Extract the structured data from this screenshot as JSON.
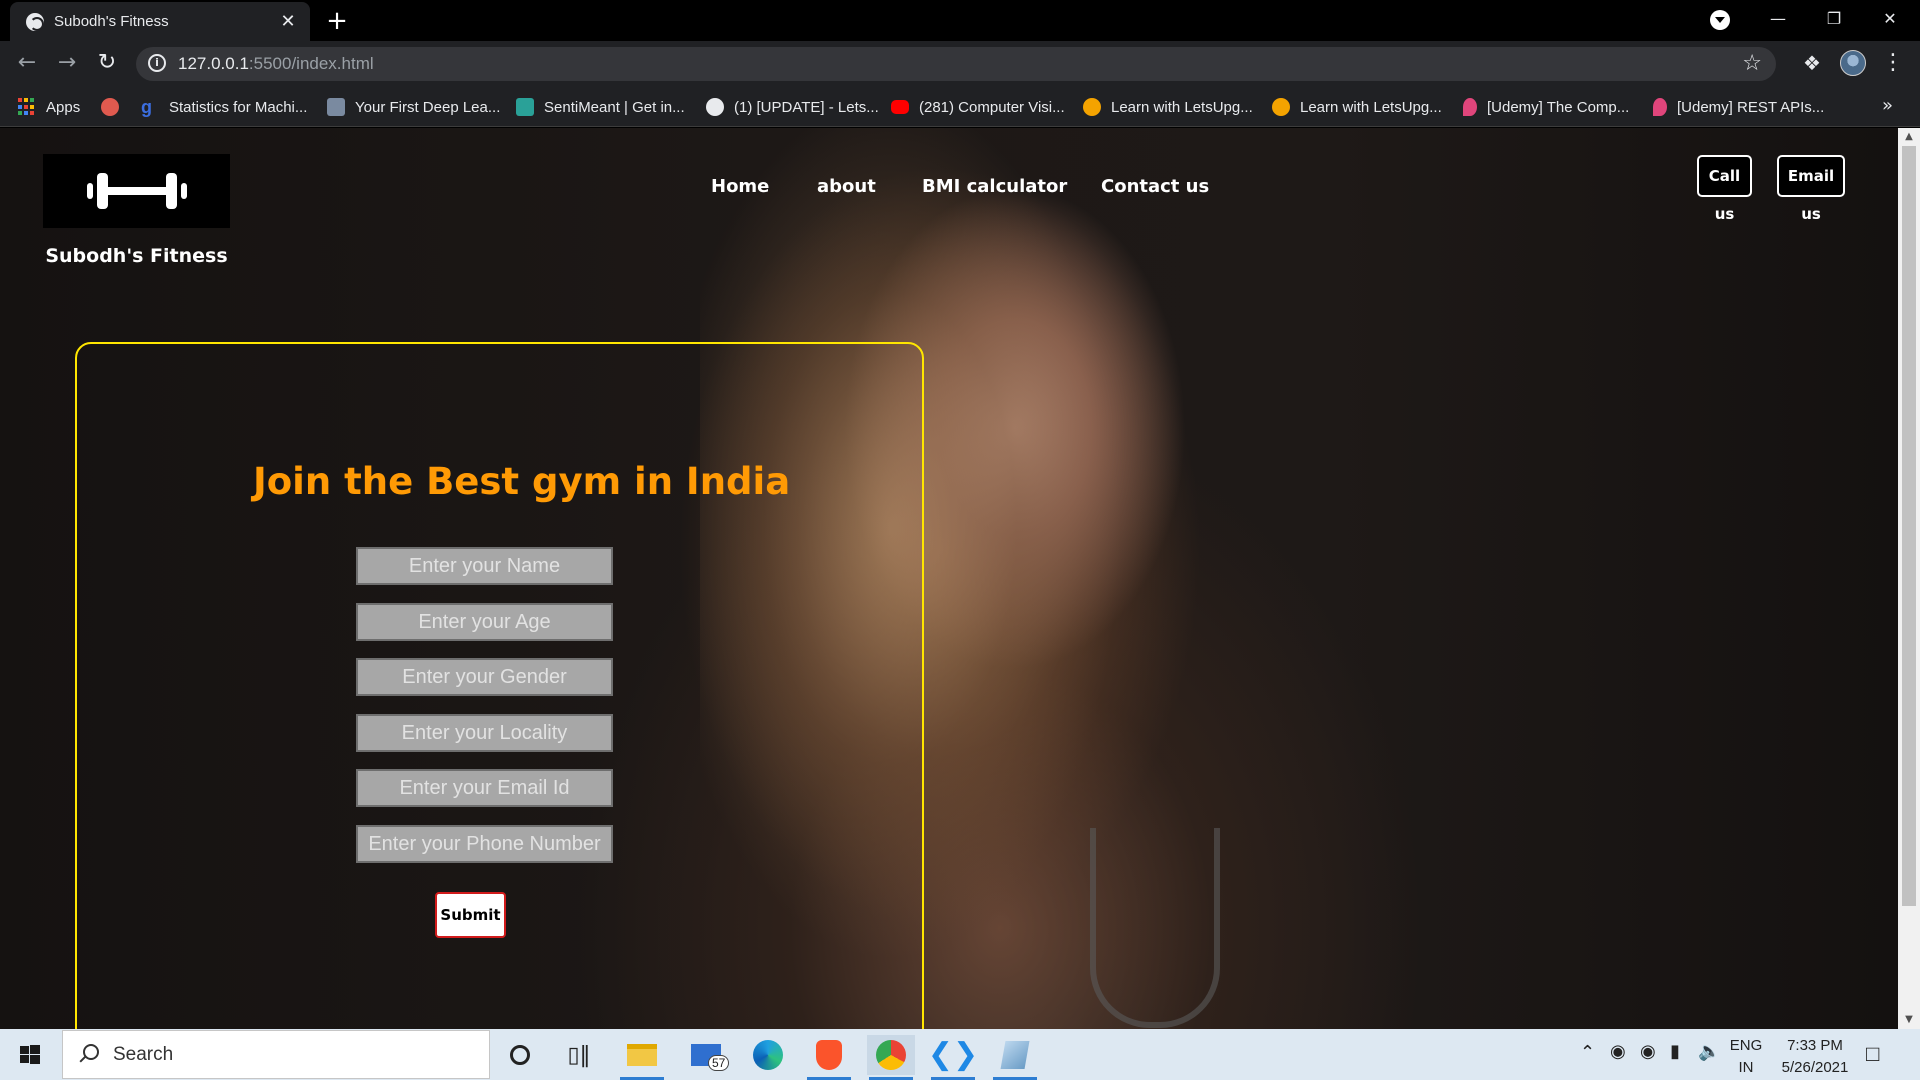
{
  "browser": {
    "tab_title": "Subodh's Fitness",
    "tab_close": "✕",
    "new_tab": "+",
    "url_host": "127.0.0.1",
    "url_path": ":5500/index.html",
    "bookmarks": [
      {
        "label": "Apps",
        "icon": "apps-grid-icon"
      },
      {
        "label": "",
        "icon": "bookmark-red-icon",
        "color": "#e05a4f"
      },
      {
        "label": "Statistics for Machi...",
        "icon": "gfg-icon",
        "color": "#2f8d46"
      },
      {
        "label": "Your First Deep Lea...",
        "icon": "image-bookmark-icon",
        "color": "#7a8aa0"
      },
      {
        "label": "SentiMeant | Get in...",
        "icon": "sentimeant-icon",
        "color": "#2aa198"
      },
      {
        "label": "(1) [UPDATE] - Lets...",
        "icon": "globe-icon",
        "color": "#e8eaed"
      },
      {
        "label": "(281) Computer Visi...",
        "icon": "youtube-icon",
        "color": "#ff0000"
      },
      {
        "label": "Learn with LetsUpg...",
        "icon": "letsupgrade-icon",
        "color": "#f4a300"
      },
      {
        "label": "Learn with LetsUpg...",
        "icon": "letsupgrade-icon",
        "color": "#f4a300"
      },
      {
        "label": "[Udemy] The Comp...",
        "icon": "udemy-pin-icon",
        "color": "#e0457b"
      },
      {
        "label": "[Udemy] REST APIs...",
        "icon": "udemy-pin-icon",
        "color": "#e0457b"
      }
    ],
    "more": "»"
  },
  "site": {
    "brand": "Subodh's Fitness",
    "nav": [
      "Home",
      "about",
      "BMI calculator",
      "Contact us"
    ],
    "call_button": "Call us",
    "email_button": "Email us",
    "form": {
      "title": "Join the Best gym in India",
      "fields": [
        "Enter your Name",
        "Enter your Age",
        "Enter your Gender",
        "Enter your Locality",
        "Enter your Email Id",
        "Enter your Phone Number"
      ],
      "submit": "Submit"
    }
  },
  "colors": {
    "form_border": "#ffe600",
    "form_title": "#ff9a05",
    "submit_border": "#d11b1b"
  },
  "taskbar": {
    "search_placeholder": "Search",
    "mail_badge": "57",
    "lang_top": "ENG",
    "lang_bottom": "IN",
    "time": "7:33 PM",
    "date": "5/26/2021"
  }
}
